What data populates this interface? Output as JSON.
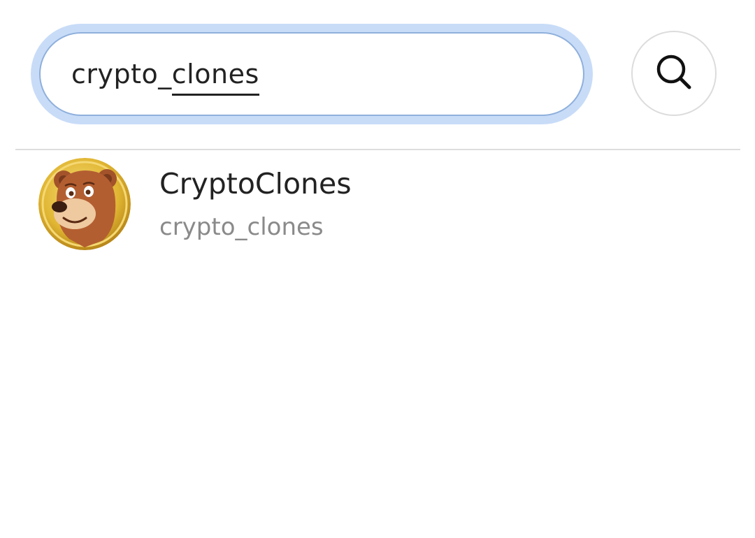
{
  "search": {
    "query_prefix": "crypto_",
    "query_suffix": "clones",
    "focus_ring_color": "#c8dcf8"
  },
  "search_button": {
    "icon": "search-icon"
  },
  "results": [
    {
      "display_name": "CryptoClones",
      "handle": "crypto_clones",
      "avatar_icon": "bear-avatar"
    }
  ]
}
